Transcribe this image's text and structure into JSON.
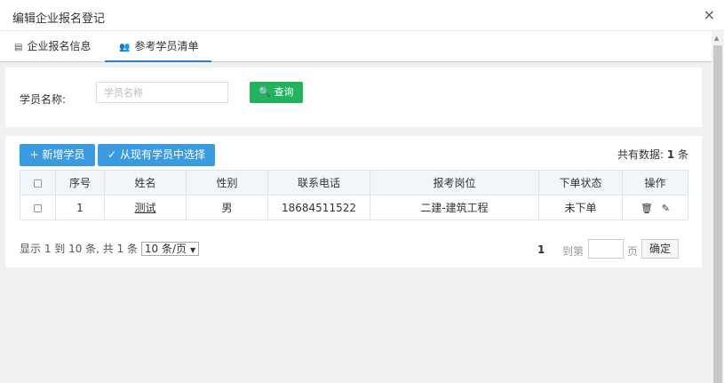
{
  "dialog": {
    "title": "编辑企业报名登记",
    "close_icon": "×"
  },
  "tabs": [
    {
      "label": "企业报名信息",
      "icon": "list-icon",
      "glyph": "▤"
    },
    {
      "label": "参考学员清单",
      "icon": "users-icon",
      "glyph": "👥",
      "active": true
    }
  ],
  "search": {
    "label": "学员名称:",
    "placeholder": "学员名称",
    "value": "",
    "button_icon": "🔍",
    "button_label": "查询"
  },
  "toolbar": {
    "add_icon": "+",
    "add_label": "新增学员",
    "select_icon": "✓",
    "select_label": "从现有学员中选择",
    "total_prefix": "共有数据: ",
    "total_count": "1",
    "total_suffix": " 条"
  },
  "table": {
    "headers": [
      "序号",
      "姓名",
      "性别",
      "联系电话",
      "报考岗位",
      "下单状态",
      "操作"
    ],
    "rows": [
      {
        "index": "1",
        "name": "测试",
        "gender": "男",
        "phone": "18684511522",
        "position": "二建-建筑工程",
        "status": "未下单",
        "delete_glyph": "🗑",
        "edit_glyph": "✎"
      }
    ]
  },
  "pager": {
    "info": "显示 1 到 10 条, 共 1 条",
    "page_size": "10 条/页",
    "current_page": "1",
    "goto_label": "到第",
    "page_unit": "页",
    "confirm_label": "确定"
  },
  "colors": {
    "accent_blue": "#3a9be0",
    "query_green": "#23b35f",
    "tab_underline": "#2d7fc2"
  }
}
